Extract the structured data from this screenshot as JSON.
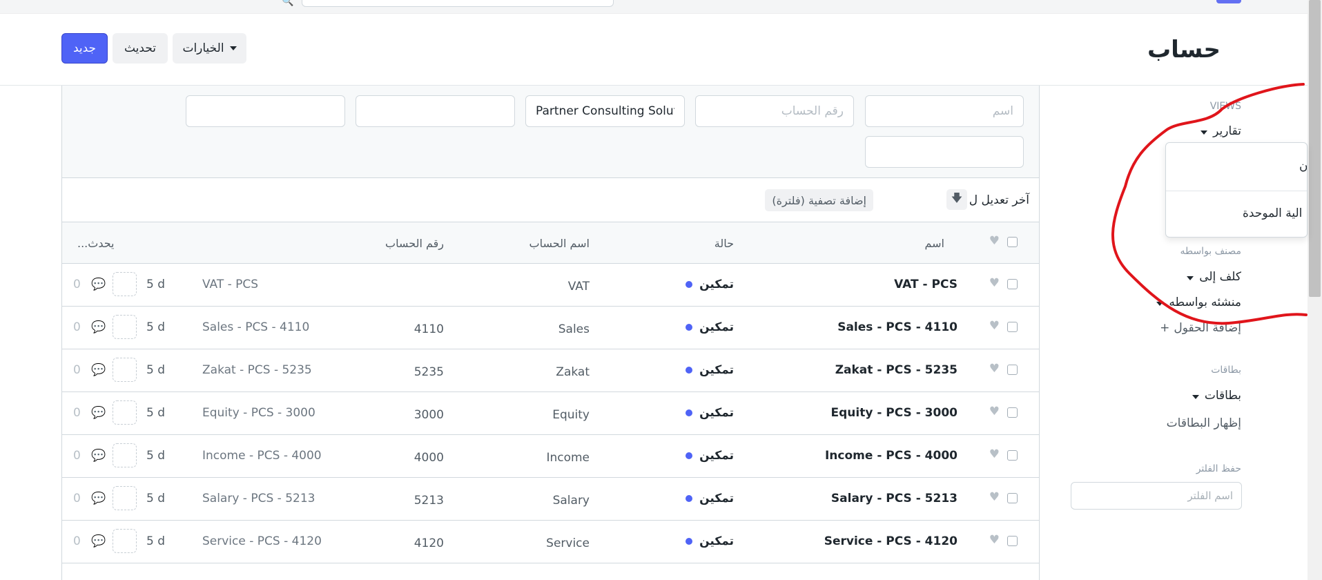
{
  "page": {
    "title": "حساب",
    "buttons": {
      "new": "جديد",
      "refresh": "تحديث",
      "options": "الخيارات"
    }
  },
  "sidebar": {
    "views_label": "VIEWS",
    "reports_label": "تقارير",
    "reports_menu": [
      "ن",
      "الية الموحدة"
    ],
    "sort_by_label": "مصنف بواسطه",
    "assigned_to": "كلف إلى",
    "created_by": "منشئه بواسطه",
    "add_fields": "إضافة الحقول",
    "cards_label": "بطاقات",
    "cards_dropdown": "بطاقات",
    "show_cards": "إظهار البطاقات",
    "save_filter_label": "حفظ الفلتر",
    "filter_name_placeholder": "اسم الفلتر"
  },
  "filters": {
    "name_placeholder": "اسم",
    "account_number_placeholder": "رقم الحساب",
    "company_value": "Partner Consulting Solutions"
  },
  "sort": {
    "label": "آخر تعديل ل",
    "add_filter": "إضافة تصفية (فلترة)"
  },
  "columns": {
    "name": "اسم",
    "status": "حالة",
    "account_name": "اسم الحساب",
    "account_number": "رقم الحساب",
    "updated": "يحدث..."
  },
  "rows": [
    {
      "name": "VAT - PCS",
      "status": "تمكين",
      "account_name": "VAT",
      "account_number": "",
      "parent": "VAT - PCS",
      "time": "5 d",
      "comments": "0"
    },
    {
      "name": "Sales - PCS - 4110",
      "status": "تمكين",
      "account_name": "Sales",
      "account_number": "4110",
      "parent": "Sales - PCS - 4110",
      "time": "5 d",
      "comments": "0"
    },
    {
      "name": "Zakat - PCS - 5235",
      "status": "تمكين",
      "account_name": "Zakat",
      "account_number": "5235",
      "parent": "Zakat - PCS - 5235",
      "time": "5 d",
      "comments": "0"
    },
    {
      "name": "Equity - PCS - 3000",
      "status": "تمكين",
      "account_name": "Equity",
      "account_number": "3000",
      "parent": "Equity - PCS - 3000",
      "time": "5 d",
      "comments": "0"
    },
    {
      "name": "Income - PCS - 4000",
      "status": "تمكين",
      "account_name": "Income",
      "account_number": "4000",
      "parent": "Income - PCS - 4000",
      "time": "5 d",
      "comments": "0"
    },
    {
      "name": "Salary - PCS - 5213",
      "status": "تمكين",
      "account_name": "Salary",
      "account_number": "5213",
      "parent": "Salary - PCS - 5213",
      "time": "5 d",
      "comments": "0"
    },
    {
      "name": "Service - PCS - 4120",
      "status": "تمكين",
      "account_name": "Service",
      "account_number": "4120",
      "parent": "Service - PCS - 4120",
      "time": "5 d",
      "comments": "0"
    }
  ],
  "colors": {
    "primary": "#4f63f6",
    "status_dot": "#4f63f6",
    "annotation": "#e0151b"
  },
  "icons": [
    "search-icon",
    "caret-down-icon",
    "sort-desc-icon",
    "heart-icon",
    "comment-icon",
    "plus-icon"
  ]
}
